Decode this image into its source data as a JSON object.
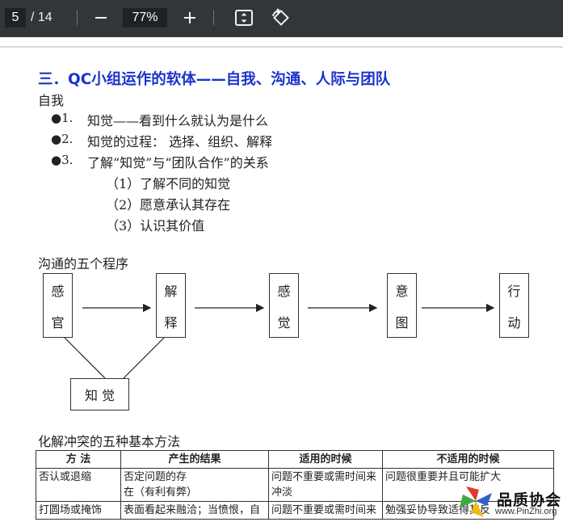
{
  "toolbar": {
    "page_current": "5",
    "page_total": "/ 14",
    "zoom": "77%",
    "zoom_out_icon": "minus-icon",
    "zoom_in_icon": "plus-icon",
    "fit_icon": "fit-page-icon",
    "rotate_icon": "rotate-icon"
  },
  "doc": {
    "title": "三．QC小组运作的软体——自我、沟通、人际与团队",
    "section_self": "自我",
    "bullets": [
      {
        "mark": "●1.",
        "text": "知觉——看到什么就认为是什么"
      },
      {
        "mark": "●2.",
        "text": "知觉的过程：  选择、组织、解释"
      },
      {
        "mark": "●3.",
        "text": "了解“知觉”与“团队合作”的关系"
      }
    ],
    "subitems": [
      "（1）了解不同的知觉",
      "（2）愿意承认其存在",
      "（3）认识其价值"
    ],
    "section_comm": "沟通的五个程序",
    "flow": [
      {
        "top": "感",
        "bottom": "官"
      },
      {
        "top": "解",
        "bottom": "释"
      },
      {
        "top": "感",
        "bottom": "觉"
      },
      {
        "top": "意",
        "bottom": "图"
      },
      {
        "top": "行",
        "bottom": "动"
      }
    ],
    "perception_box": "知  觉",
    "section_conflict": "化解冲突的五种基本方法",
    "table": {
      "headers": [
        "方  法",
        "产生的结果",
        "适用的时候",
        "不适用的时候"
      ],
      "rows": [
        [
          "否认或退缩",
          "否定问题的存|在（有利有弊）",
          "问题不重要或需时间来|冲淡",
          "问题很重要并且可能扩大"
        ],
        [
          "打圆场或掩饰",
          "表面看起来融洽；当愤恨，自",
          "问题不重要或需时间来",
          "勉强妥协导致适得其反"
        ]
      ]
    }
  },
  "watermark": {
    "name": "品质协会",
    "url": "www.PinZhi.org"
  },
  "colors": {
    "toolbar_bg": "#323639",
    "title_blue": "#1a33cc"
  }
}
